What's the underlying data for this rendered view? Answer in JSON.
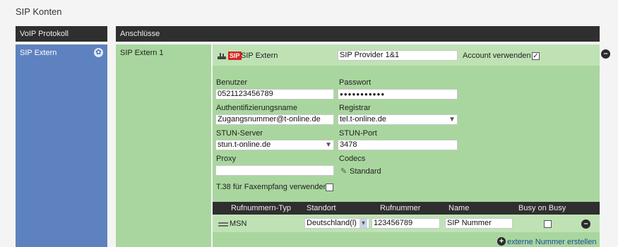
{
  "page": {
    "title": "SIP Konten"
  },
  "headers": {
    "left": "VoIP Protokoll",
    "right": "Anschlüsse"
  },
  "left": {
    "item": "SIP Extern",
    "icon": "gear-icon"
  },
  "mid": {
    "item": "SIP Extern 1"
  },
  "account": {
    "badge": "SIP",
    "name": "SIP Extern",
    "provider": "SIP Provider 1&1",
    "use_label": "Account verwenden",
    "use_checked": true
  },
  "form": {
    "benutzer_label": "Benutzer",
    "benutzer_value": "0521123456789",
    "passwort_label": "Passwort",
    "passwort_value": "●●●●●●●●●●●",
    "auth_label": "Authentifizierungsname",
    "auth_value": "Zugangsnummer@t-online.de",
    "registrar_label": "Registrar",
    "registrar_value": "tel.t-online.de",
    "stun_label": "STUN-Server",
    "stun_value": "stun.t-online.de",
    "stunport_label": "STUN-Port",
    "stunport_value": "3478",
    "proxy_label": "Proxy",
    "proxy_value": "",
    "codecs_label": "Codecs",
    "codecs_value": "Standard",
    "t38_label": "T.38 für Faxempfang verwenden",
    "t38_checked": false
  },
  "table": {
    "headers": [
      "Rufnummern-Typ",
      "Standort",
      "Rufnummer",
      "Name",
      "Busy on Busy"
    ],
    "row": {
      "type": "MSN",
      "location": "Deutschland(l)",
      "number": "123456789",
      "name": "SIP Nummer",
      "busy_checked": false
    }
  },
  "add_link": "externe Nummer erstellen"
}
